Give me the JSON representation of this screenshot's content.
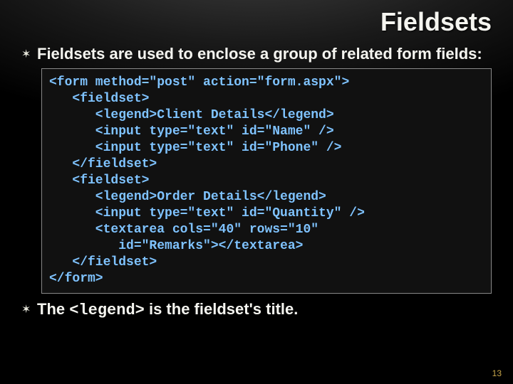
{
  "title": "Fieldsets",
  "bullets": {
    "first": {
      "lead": "Fieldsets",
      "rest": " are used to enclose a group of related form fields:"
    },
    "second": {
      "lead": "The ",
      "mono": "<legend>",
      "rest": " is the fieldset's title."
    }
  },
  "code": {
    "l1": "<form method=\"post\" action=\"form.aspx\">",
    "l2": "   <fieldset>",
    "l3": "      <legend>Client Details</legend>",
    "l4": "      <input type=\"text\" id=\"Name\" />",
    "l5": "      <input type=\"text\" id=\"Phone\" />",
    "l6": "   </fieldset>",
    "l7": "   <fieldset>",
    "l8": "      <legend>Order Details</legend>",
    "l9": "      <input type=\"text\" id=\"Quantity\" />",
    "l10a": "      <textarea cols=\"40\" rows=\"10\"",
    "l10b": "         id=\"Remarks\"></textarea>",
    "l11": "   </fieldset>",
    "l12": "</form>"
  },
  "pagenum": "13"
}
